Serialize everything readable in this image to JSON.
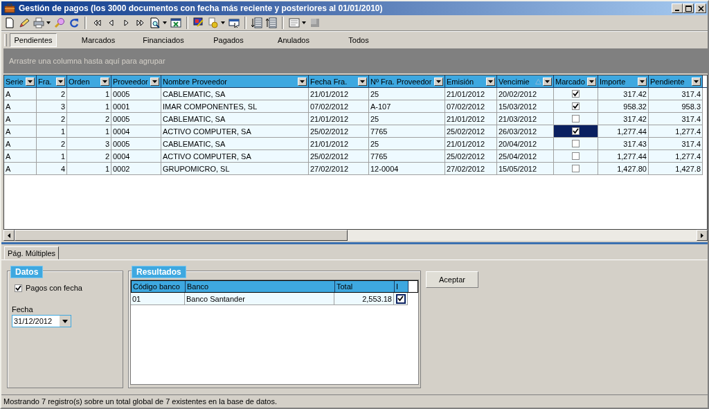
{
  "window": {
    "title": "Gestión de pagos (los 3000 documentos con fecha más reciente y posteriores al 01/01/2010)"
  },
  "tabs": [
    {
      "label": "Pendientes",
      "selected": true
    },
    {
      "label": "Marcados",
      "selected": false
    },
    {
      "label": "Financiados",
      "selected": false
    },
    {
      "label": "Pagados",
      "selected": false
    },
    {
      "label": "Anulados",
      "selected": false
    },
    {
      "label": "Todos",
      "selected": false
    }
  ],
  "group_area": {
    "hint": "Arrastre una columna hasta aquí para agrupar"
  },
  "table": {
    "columns": [
      {
        "label": "Serie",
        "kind": "text",
        "sorted": false
      },
      {
        "label": "Fra.",
        "kind": "number",
        "sorted": false
      },
      {
        "label": "Orden",
        "kind": "number",
        "sorted": false
      },
      {
        "label": "Proveedor",
        "kind": "text",
        "sorted": false
      },
      {
        "label": "Nombre Proveedor",
        "kind": "text",
        "sorted": false
      },
      {
        "label": "Fecha Fra.",
        "kind": "text",
        "sorted": false
      },
      {
        "label": "Nº Fra. Proveedor",
        "kind": "text",
        "sorted": false
      },
      {
        "label": "Emisión",
        "kind": "text",
        "sorted": false
      },
      {
        "label": "Vencimie",
        "kind": "text",
        "sorted": true
      },
      {
        "label": "Marcado",
        "kind": "check",
        "sorted": false
      },
      {
        "label": "Importe",
        "kind": "number",
        "sorted": false
      },
      {
        "label": "Pendiente",
        "kind": "number",
        "sorted": false
      }
    ],
    "rows": [
      {
        "cells": [
          "A",
          "2",
          "1",
          "0005",
          "CABLEMATIC, SA",
          "21/01/2012",
          "25",
          "21/01/2012",
          "20/02/2012",
          "317.42",
          "317.4"
        ],
        "checked": true,
        "selected": false
      },
      {
        "cells": [
          "A",
          "3",
          "1",
          "0001",
          "IMAR COMPONENTES, SL",
          "07/02/2012",
          "A-107",
          "07/02/2012",
          "15/03/2012",
          "958.32",
          "958.3"
        ],
        "checked": true,
        "selected": false
      },
      {
        "cells": [
          "A",
          "2",
          "2",
          "0005",
          "CABLEMATIC, SA",
          "21/01/2012",
          "25",
          "21/01/2012",
          "21/03/2012",
          "317.42",
          "317.4"
        ],
        "checked": false,
        "selected": false
      },
      {
        "cells": [
          "A",
          "1",
          "1",
          "0004",
          "ACTIVO COMPUTER, SA",
          "25/02/2012",
          "7765",
          "25/02/2012",
          "26/03/2012",
          "1,277.44",
          "1,277.4"
        ],
        "checked": true,
        "selected": true
      },
      {
        "cells": [
          "A",
          "2",
          "3",
          "0005",
          "CABLEMATIC, SA",
          "21/01/2012",
          "25",
          "21/01/2012",
          "20/04/2012",
          "317.43",
          "317.4"
        ],
        "checked": false,
        "selected": false
      },
      {
        "cells": [
          "A",
          "1",
          "2",
          "0004",
          "ACTIVO COMPUTER, SA",
          "25/02/2012",
          "7765",
          "25/02/2012",
          "25/04/2012",
          "1,277.44",
          "1,277.4"
        ],
        "checked": false,
        "selected": false
      },
      {
        "cells": [
          "A",
          "4",
          "1",
          "0002",
          "GRUPOMICRO, SL",
          "27/02/2012",
          "12-0004",
          "27/02/2012",
          "15/05/2012",
          "1,427.80",
          "1,427.8"
        ],
        "checked": false,
        "selected": false
      }
    ]
  },
  "bottom_tabs": [
    {
      "label": "Pág. Múltiples",
      "selected": true
    }
  ],
  "datos": {
    "title": "Datos",
    "checkbox": {
      "label": "Pagos con fecha",
      "checked": true
    },
    "date_label": "Fecha",
    "date_value": "31/12/2012"
  },
  "resultados": {
    "title": "Resultados",
    "columns": [
      "Código banco",
      "Banco",
      "Total",
      "I"
    ],
    "rows": [
      {
        "cells": [
          "01",
          "Banco Santander",
          "2,553.18"
        ],
        "checked": true
      }
    ]
  },
  "accept_button": "Aceptar",
  "status_bar": "Mostrando 7 registro(s) sobre un total global de 7 existentes en la base de datos."
}
